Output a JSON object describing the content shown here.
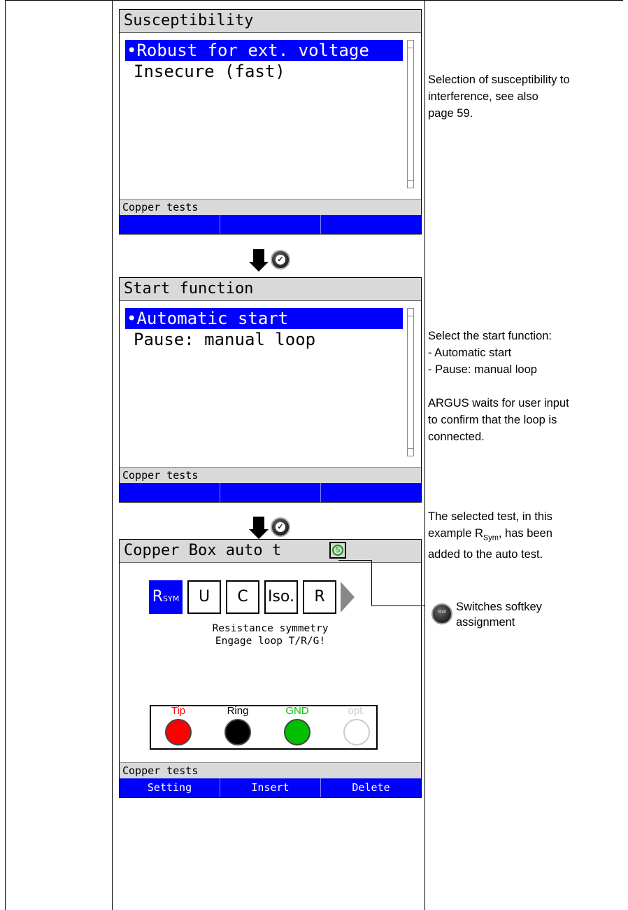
{
  "screens": [
    {
      "title": "Susceptibility",
      "items": [
        "•Robust for ext. voltage",
        "Insecure (fast)"
      ],
      "status": "Copper tests"
    },
    {
      "title": "Start function",
      "items": [
        "•Automatic start",
        "Pause: manual loop"
      ],
      "status": "Copper tests"
    },
    {
      "title": "Copper Box auto t",
      "title_icon": "S",
      "tiles": [
        "R",
        "U",
        "C",
        "Iso.",
        "R"
      ],
      "tile_sub": "SYM",
      "message_line1": "Resistance symmetry",
      "message_line2": "Engage loop T/R/G!",
      "leads": [
        "Tip",
        "Ring",
        "GND",
        "opt."
      ],
      "status": "Copper tests",
      "softkeys": [
        "Setting",
        "Insert",
        "Delete"
      ]
    }
  ],
  "descriptions": {
    "d1": [
      "Selection of susceptibility to",
      "interference, see also",
      "page 59."
    ],
    "d2": [
      "Select the start function:",
      "- Automatic start",
      "- Pause: manual loop",
      "",
      "ARGUS waits for user input",
      "to confirm that the loop is",
      "connected."
    ],
    "d3_line1": "The selected test, in this",
    "d3_line2_pre": "example R",
    "d3_line2_sub": "Sym",
    "d3_line2_post": ", has been",
    "d3_line3": "added to the auto test.",
    "d4": [
      "Switches softkey",
      "assignment"
    ],
    "shift_label": "Shift"
  },
  "colors": {
    "softkey_bg": "#0000ff",
    "tip": "#ff0000",
    "ring": "#000000",
    "gnd": "#00c000",
    "opt": "#ffffff"
  }
}
